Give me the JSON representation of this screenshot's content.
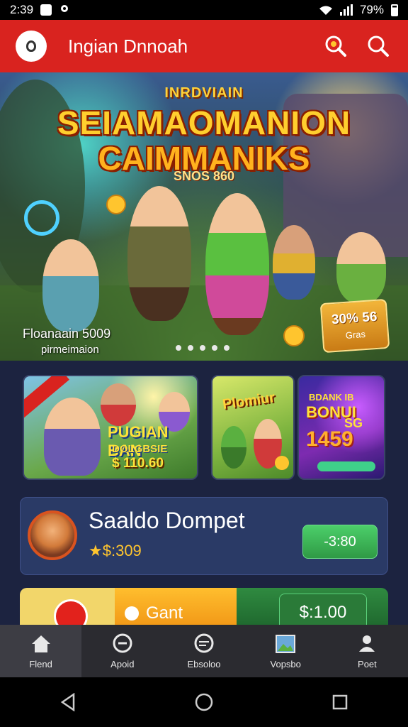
{
  "status_bar": {
    "time": "2:39",
    "battery": "79%"
  },
  "app_bar": {
    "title": "Ingian Dnnoah"
  },
  "hero": {
    "supertitle": "INRDVIAIN",
    "title_line1": "SEIAMAOMANION",
    "title_line2": "CAIMMANIKS",
    "subtitle": "SNOS 860",
    "caption_line1": "Floanaain 5009",
    "caption_line2": "pirmeimaion",
    "badge_value": "30% 56",
    "badge_label": "Gras",
    "slides": 5,
    "active_slide": 1
  },
  "promos": [
    {
      "line1": "PUGIAN BAN",
      "line2": "DOLGBSIE",
      "price": "$ 110.60"
    },
    {
      "label": "Plomiur"
    },
    {
      "line1": "BDANK IB",
      "line2": "BONUI",
      "line3": "SG",
      "value": "1459"
    }
  ],
  "wallet": {
    "title": "Saaldo Dompet",
    "balance": "$:309",
    "button_label": "-3:80"
  },
  "strip": {
    "gift_label": "Gant",
    "amount": "$:1.00"
  },
  "bottom_nav": [
    {
      "label": "Flend",
      "icon": "home-icon"
    },
    {
      "label": "Apoid",
      "icon": "chat-icon"
    },
    {
      "label": "Ebsoloo",
      "icon": "message-icon"
    },
    {
      "label": "Vopsbo",
      "icon": "image-icon"
    },
    {
      "label": "Poet",
      "icon": "profile-icon"
    }
  ],
  "colors": {
    "app_bar": "#d9231f",
    "background": "#1c2340",
    "accent_green": "#2f9a45",
    "accent_gold": "#ffc52e"
  }
}
